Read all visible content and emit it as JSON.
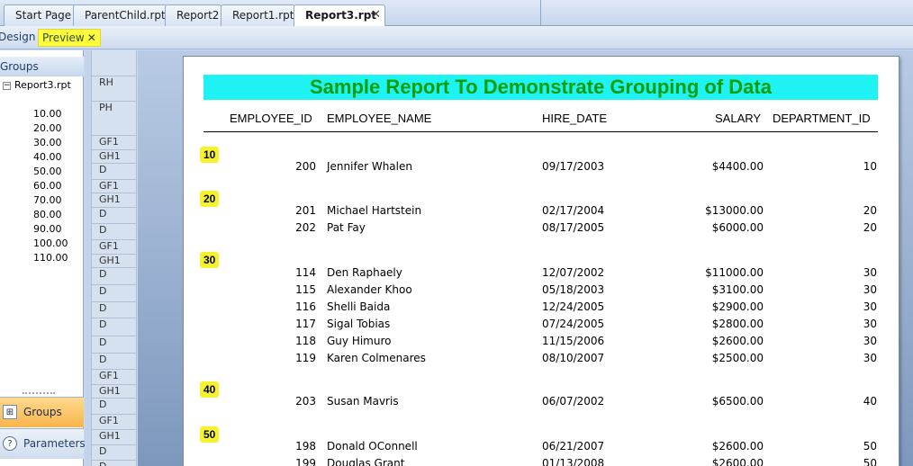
{
  "tabs": [
    {
      "label": "Start Page"
    },
    {
      "label": "ParentChild.rpt"
    },
    {
      "label": "Report2"
    },
    {
      "label": "Report1.rpt"
    },
    {
      "label": "Report3.rpt",
      "close": "✕"
    }
  ],
  "subtabs": {
    "design": "Design",
    "preview": "Preview",
    "preview_close": "✕"
  },
  "left_panel": {
    "header": "Groups",
    "tree_root": "Report3.rpt",
    "tree_items": [
      "10.00",
      "20.00",
      "30.00",
      "40.00",
      "50.00",
      "60.00",
      "70.00",
      "80.00",
      "90.00",
      "100.00",
      "110.00"
    ],
    "groups_button": "Groups",
    "params_button": "Parameters"
  },
  "bands": [
    "RH",
    "PH",
    "GF1",
    "GH1",
    "D",
    "GF1",
    "GH1",
    "D",
    "D",
    "GF1",
    "GH1",
    "D",
    "D",
    "D",
    "D",
    "D",
    "D",
    "GF1",
    "GH1",
    "D",
    "GF1",
    "GH1",
    "D",
    "D"
  ],
  "report": {
    "title": "Sample Report To Demonstrate Grouping of Data",
    "columns": [
      "EMPLOYEE_ID",
      "EMPLOYEE_NAME",
      "HIRE_DATE",
      "SALARY",
      "DEPARTMENT_ID"
    ],
    "groups": [
      {
        "label": "10",
        "rows": [
          {
            "id": "200",
            "name": "Jennifer Whalen",
            "date": "09/17/2003",
            "salary": "$4400.00",
            "dept": "10"
          }
        ]
      },
      {
        "label": "20",
        "rows": [
          {
            "id": "201",
            "name": "Michael Hartstein",
            "date": "02/17/2004",
            "salary": "$13000.00",
            "dept": "20"
          },
          {
            "id": "202",
            "name": "Pat Fay",
            "date": "08/17/2005",
            "salary": "$6000.00",
            "dept": "20"
          }
        ]
      },
      {
        "label": "30",
        "rows": [
          {
            "id": "114",
            "name": "Den Raphaely",
            "date": "12/07/2002",
            "salary": "$11000.00",
            "dept": "30"
          },
          {
            "id": "115",
            "name": "Alexander Khoo",
            "date": "05/18/2003",
            "salary": "$3100.00",
            "dept": "30"
          },
          {
            "id": "116",
            "name": "Shelli Baida",
            "date": "12/24/2005",
            "salary": "$2900.00",
            "dept": "30"
          },
          {
            "id": "117",
            "name": "Sigal Tobias",
            "date": "07/24/2005",
            "salary": "$2800.00",
            "dept": "30"
          },
          {
            "id": "118",
            "name": "Guy Himuro",
            "date": "11/15/2006",
            "salary": "$2600.00",
            "dept": "30"
          },
          {
            "id": "119",
            "name": "Karen Colmenares",
            "date": "08/10/2007",
            "salary": "$2500.00",
            "dept": "30"
          }
        ]
      },
      {
        "label": "40",
        "rows": [
          {
            "id": "203",
            "name": "Susan Mavris",
            "date": "06/07/2002",
            "salary": "$6500.00",
            "dept": "40"
          }
        ]
      },
      {
        "label": "50",
        "rows": [
          {
            "id": "198",
            "name": "Donald OConnell",
            "date": "06/21/2007",
            "salary": "$2600.00",
            "dept": "50"
          },
          {
            "id": "199",
            "name": "Douglas Grant",
            "date": "01/13/2008",
            "salary": "$2600.00",
            "dept": "50"
          }
        ]
      }
    ]
  }
}
